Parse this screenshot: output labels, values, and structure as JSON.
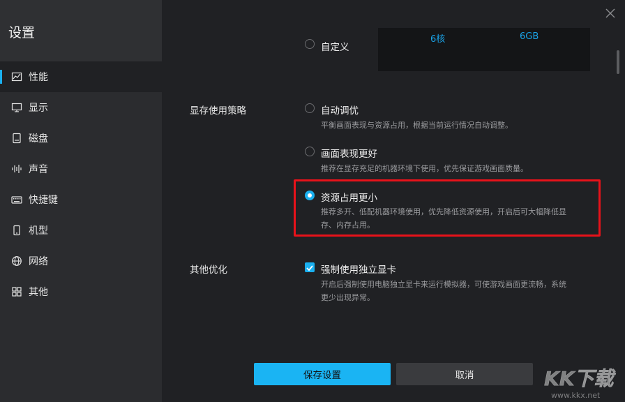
{
  "sidebar": {
    "title": "设置",
    "items": [
      {
        "label": "性能",
        "icon": "chart-line-icon"
      },
      {
        "label": "显示",
        "icon": "monitor-icon"
      },
      {
        "label": "磁盘",
        "icon": "disk-icon"
      },
      {
        "label": "声音",
        "icon": "sound-wave-icon"
      },
      {
        "label": "快捷键",
        "icon": "keyboard-icon"
      },
      {
        "label": "机型",
        "icon": "phone-icon"
      },
      {
        "label": "网络",
        "icon": "globe-icon"
      },
      {
        "label": "其他",
        "icon": "grid-icon"
      }
    ],
    "active_index": 0
  },
  "custom": {
    "label": "自定义",
    "cpu": "6核",
    "ram": "6GB"
  },
  "vram_strategy": {
    "label": "显存使用策略",
    "options": [
      {
        "title": "自动调优",
        "desc": "平衡画面表现与资源占用，根据当前运行情况自动调整。",
        "checked": false
      },
      {
        "title": "画面表现更好",
        "desc": "推荐在显存充足的机器环境下使用，优先保证游戏画面质量。",
        "checked": false
      },
      {
        "title": "资源占用更小",
        "desc_line1": "推荐多开、低配机器环境使用，优先降低资源使用，开启后可大幅降低显",
        "desc_line2": "存、内存占用。",
        "checked": true
      }
    ]
  },
  "other": {
    "label": "其他优化",
    "force_gpu": {
      "title": "强制使用独立显卡",
      "desc_line1": "开启后强制使用电脑独立显卡来运行模拟器，可使游戏画面更流畅，系统",
      "desc_line2": "更少出现异常。",
      "checked": true
    }
  },
  "buttons": {
    "save": "保存设置",
    "cancel": "取消"
  },
  "watermark": {
    "logo": "KK下载",
    "url": "www.kkx.net"
  },
  "colors": {
    "accent": "#1ab0f0",
    "highlight": "#e8121a"
  }
}
